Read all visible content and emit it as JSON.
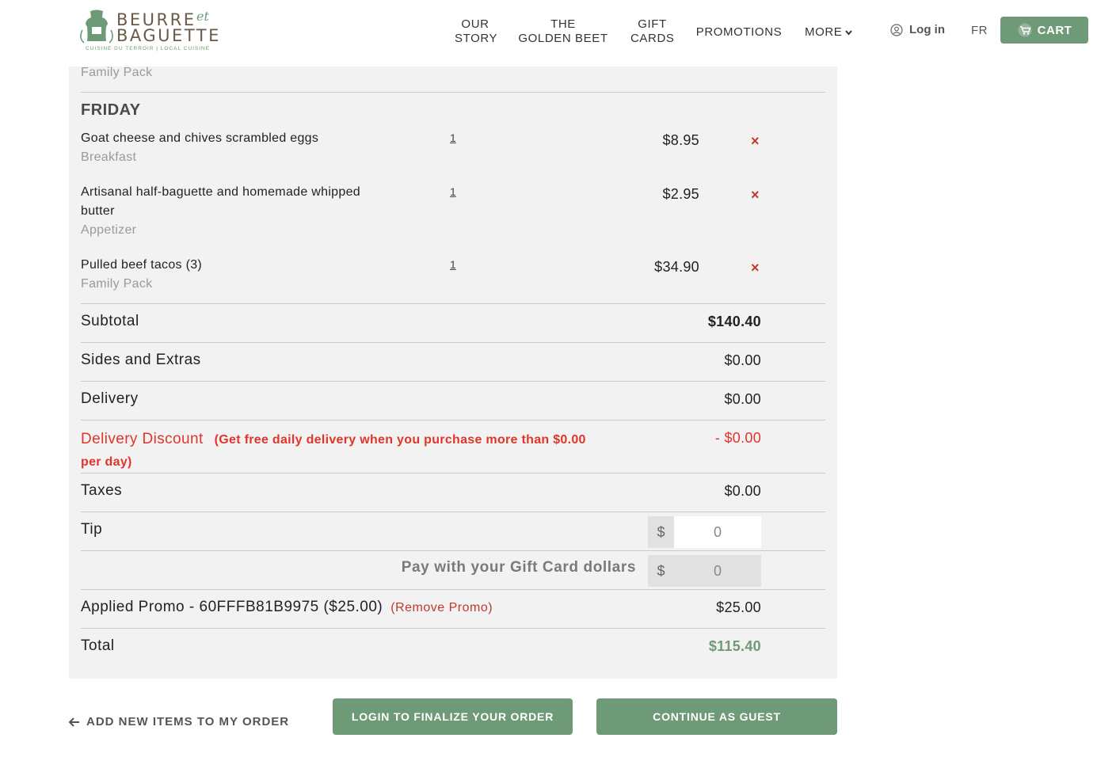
{
  "header": {
    "logo": {
      "line1": "BEURRE",
      "et": "et",
      "line2": "BAGUETTE",
      "tagline": "CUISINE DU TERROIR | LOCAL CUISINE"
    },
    "nav": [
      {
        "label_line1": "OUR",
        "label_line2": "STORY"
      },
      {
        "label_line1": "THE",
        "label_line2": "GOLDEN BEET"
      },
      {
        "label_line1": "GIFT",
        "label_line2": "CARDS"
      },
      {
        "label": "PROMOTIONS"
      },
      {
        "label": "MORE"
      }
    ],
    "login_label": "Log in",
    "lang_label": "FR",
    "cart_label": "CART"
  },
  "order": {
    "prev_item_category": "Family Pack",
    "day_label": "FRIDAY",
    "items": [
      {
        "name": "Goat cheese and chives scrambled eggs",
        "category": "Breakfast",
        "qty": "1",
        "price": "$8.95",
        "remove_icon": "×"
      },
      {
        "name": "Artisanal half-baguette and homemade whipped butter",
        "category": "Appetizer",
        "qty": "1",
        "price": "$2.95",
        "remove_icon": "×"
      },
      {
        "name": "Pulled beef tacos (3)",
        "category": "Family Pack",
        "qty": "1",
        "price": "$34.90",
        "remove_icon": "×"
      }
    ]
  },
  "summary": {
    "subtotal_label": "Subtotal",
    "subtotal_value": "$140.40",
    "sides_label": "Sides and Extras",
    "sides_value": "$0.00",
    "delivery_label": "Delivery",
    "delivery_value": "$0.00",
    "discount_label": "Delivery Discount",
    "discount_note": "(Get free daily delivery when you purchase more than $0.00 per day)",
    "discount_value": "- $0.00",
    "taxes_label": "Taxes",
    "taxes_value": "$0.00",
    "tip_label": "Tip",
    "tip_currency": "$",
    "tip_value": "0",
    "giftcard_label": "Pay with your Gift Card dollars",
    "giftcard_currency": "$",
    "giftcard_value": "0",
    "promo_label": "Applied Promo - 60FFFB81B9975 ($25.00)",
    "promo_remove": "(Remove Promo)",
    "promo_value": "$25.00",
    "total_label": "Total",
    "total_value": "$115.40"
  },
  "actions": {
    "back_label": "ADD NEW ITEMS TO MY ORDER",
    "login_finalize": "LOGIN TO FINALIZE YOUR ORDER",
    "guest": "CONTINUE AS GUEST"
  },
  "colors": {
    "accent_green": "#6f9a78",
    "danger_red": "#e0352b",
    "panel_bg": "#f2f2f2"
  }
}
